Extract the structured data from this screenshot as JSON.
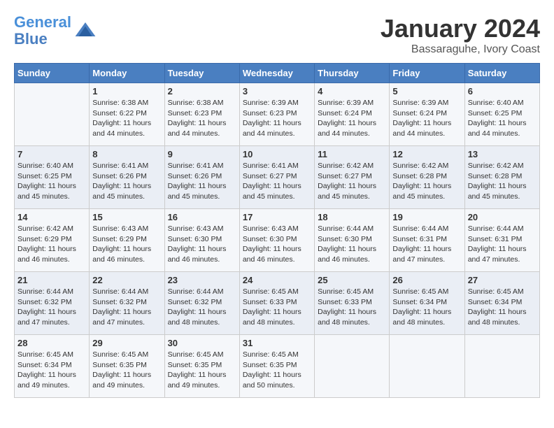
{
  "header": {
    "logo_line1": "General",
    "logo_line2": "Blue",
    "month_year": "January 2024",
    "location": "Bassaraguhe, Ivory Coast"
  },
  "weekdays": [
    "Sunday",
    "Monday",
    "Tuesday",
    "Wednesday",
    "Thursday",
    "Friday",
    "Saturday"
  ],
  "weeks": [
    [
      {
        "day": "",
        "info": ""
      },
      {
        "day": "1",
        "info": "Sunrise: 6:38 AM\nSunset: 6:22 PM\nDaylight: 11 hours\nand 44 minutes."
      },
      {
        "day": "2",
        "info": "Sunrise: 6:38 AM\nSunset: 6:23 PM\nDaylight: 11 hours\nand 44 minutes."
      },
      {
        "day": "3",
        "info": "Sunrise: 6:39 AM\nSunset: 6:23 PM\nDaylight: 11 hours\nand 44 minutes."
      },
      {
        "day": "4",
        "info": "Sunrise: 6:39 AM\nSunset: 6:24 PM\nDaylight: 11 hours\nand 44 minutes."
      },
      {
        "day": "5",
        "info": "Sunrise: 6:39 AM\nSunset: 6:24 PM\nDaylight: 11 hours\nand 44 minutes."
      },
      {
        "day": "6",
        "info": "Sunrise: 6:40 AM\nSunset: 6:25 PM\nDaylight: 11 hours\nand 44 minutes."
      }
    ],
    [
      {
        "day": "7",
        "info": "Sunrise: 6:40 AM\nSunset: 6:25 PM\nDaylight: 11 hours\nand 45 minutes."
      },
      {
        "day": "8",
        "info": "Sunrise: 6:41 AM\nSunset: 6:26 PM\nDaylight: 11 hours\nand 45 minutes."
      },
      {
        "day": "9",
        "info": "Sunrise: 6:41 AM\nSunset: 6:26 PM\nDaylight: 11 hours\nand 45 minutes."
      },
      {
        "day": "10",
        "info": "Sunrise: 6:41 AM\nSunset: 6:27 PM\nDaylight: 11 hours\nand 45 minutes."
      },
      {
        "day": "11",
        "info": "Sunrise: 6:42 AM\nSunset: 6:27 PM\nDaylight: 11 hours\nand 45 minutes."
      },
      {
        "day": "12",
        "info": "Sunrise: 6:42 AM\nSunset: 6:28 PM\nDaylight: 11 hours\nand 45 minutes."
      },
      {
        "day": "13",
        "info": "Sunrise: 6:42 AM\nSunset: 6:28 PM\nDaylight: 11 hours\nand 45 minutes."
      }
    ],
    [
      {
        "day": "14",
        "info": "Sunrise: 6:42 AM\nSunset: 6:29 PM\nDaylight: 11 hours\nand 46 minutes."
      },
      {
        "day": "15",
        "info": "Sunrise: 6:43 AM\nSunset: 6:29 PM\nDaylight: 11 hours\nand 46 minutes."
      },
      {
        "day": "16",
        "info": "Sunrise: 6:43 AM\nSunset: 6:30 PM\nDaylight: 11 hours\nand 46 minutes."
      },
      {
        "day": "17",
        "info": "Sunrise: 6:43 AM\nSunset: 6:30 PM\nDaylight: 11 hours\nand 46 minutes."
      },
      {
        "day": "18",
        "info": "Sunrise: 6:44 AM\nSunset: 6:30 PM\nDaylight: 11 hours\nand 46 minutes."
      },
      {
        "day": "19",
        "info": "Sunrise: 6:44 AM\nSunset: 6:31 PM\nDaylight: 11 hours\nand 47 minutes."
      },
      {
        "day": "20",
        "info": "Sunrise: 6:44 AM\nSunset: 6:31 PM\nDaylight: 11 hours\nand 47 minutes."
      }
    ],
    [
      {
        "day": "21",
        "info": "Sunrise: 6:44 AM\nSunset: 6:32 PM\nDaylight: 11 hours\nand 47 minutes."
      },
      {
        "day": "22",
        "info": "Sunrise: 6:44 AM\nSunset: 6:32 PM\nDaylight: 11 hours\nand 47 minutes."
      },
      {
        "day": "23",
        "info": "Sunrise: 6:44 AM\nSunset: 6:32 PM\nDaylight: 11 hours\nand 48 minutes."
      },
      {
        "day": "24",
        "info": "Sunrise: 6:45 AM\nSunset: 6:33 PM\nDaylight: 11 hours\nand 48 minutes."
      },
      {
        "day": "25",
        "info": "Sunrise: 6:45 AM\nSunset: 6:33 PM\nDaylight: 11 hours\nand 48 minutes."
      },
      {
        "day": "26",
        "info": "Sunrise: 6:45 AM\nSunset: 6:34 PM\nDaylight: 11 hours\nand 48 minutes."
      },
      {
        "day": "27",
        "info": "Sunrise: 6:45 AM\nSunset: 6:34 PM\nDaylight: 11 hours\nand 48 minutes."
      }
    ],
    [
      {
        "day": "28",
        "info": "Sunrise: 6:45 AM\nSunset: 6:34 PM\nDaylight: 11 hours\nand 49 minutes."
      },
      {
        "day": "29",
        "info": "Sunrise: 6:45 AM\nSunset: 6:35 PM\nDaylight: 11 hours\nand 49 minutes."
      },
      {
        "day": "30",
        "info": "Sunrise: 6:45 AM\nSunset: 6:35 PM\nDaylight: 11 hours\nand 49 minutes."
      },
      {
        "day": "31",
        "info": "Sunrise: 6:45 AM\nSunset: 6:35 PM\nDaylight: 11 hours\nand 50 minutes."
      },
      {
        "day": "",
        "info": ""
      },
      {
        "day": "",
        "info": ""
      },
      {
        "day": "",
        "info": ""
      }
    ]
  ]
}
